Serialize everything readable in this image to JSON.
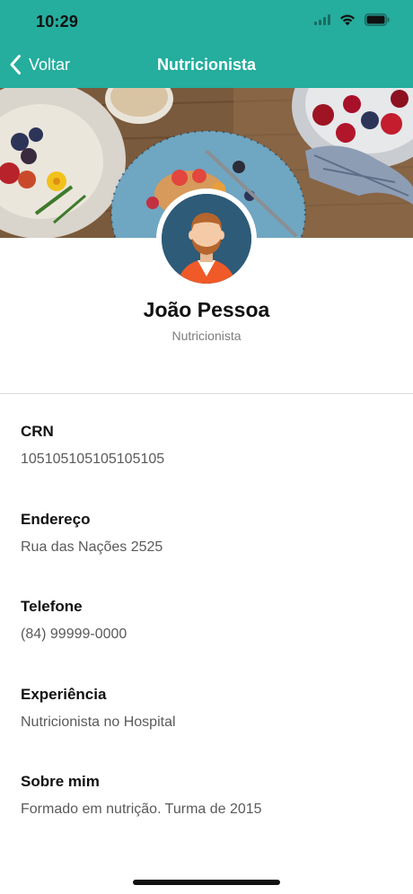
{
  "status_bar": {
    "time": "10:29"
  },
  "nav": {
    "back_label": "Voltar",
    "title": "Nutricionista"
  },
  "profile": {
    "name": "João Pessoa",
    "role": "Nutricionista"
  },
  "details": [
    {
      "label": "CRN",
      "value": "105105105105105105"
    },
    {
      "label": "Endereço",
      "value": "Rua das Nações 2525"
    },
    {
      "label": "Telefone",
      "value": "(84) 99999-0000"
    },
    {
      "label": "Experiência",
      "value": "Nutricionista no Hospital"
    },
    {
      "label": "Sobre mim",
      "value": "Formado em nutrição. Turma de 2015"
    }
  ],
  "colors": {
    "accent": "#25ad9d",
    "text": "#111111",
    "secondary_text": "#5a5a5a",
    "divider": "#dcdcdc"
  },
  "icons": {
    "back": "chevron-left-icon",
    "signal": "cellular-signal-icon",
    "wifi": "wifi-icon",
    "battery": "battery-icon",
    "avatar": "person-avatar-icon"
  }
}
